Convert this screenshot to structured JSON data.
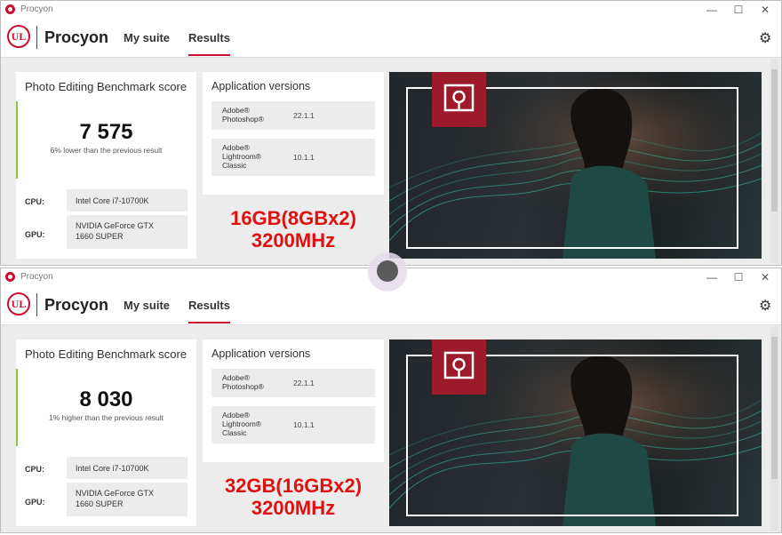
{
  "windows": [
    {
      "title": "Procyon",
      "brand": "Procyon",
      "logo_text": "UL",
      "nav": [
        {
          "label": "My suite"
        },
        {
          "label": "Results"
        }
      ],
      "score_title": "Photo Editing Benchmark score",
      "score": "7 575",
      "comparison": "6% lower than the previous result",
      "cpu_label": "CPU:",
      "cpu": "Intel Core i7-10700K",
      "gpu_label": "GPU:",
      "gpu_line1": "NVIDIA GeForce GTX",
      "gpu_line2": "1660 SUPER",
      "app_versions_title": "Application versions",
      "apps": [
        {
          "name": [
            "Adobe®",
            "Photoshop®"
          ],
          "version": "22.1.1"
        },
        {
          "name": [
            "Adobe®",
            "Lightroom®",
            "Classic"
          ],
          "version": "10.1.1"
        }
      ],
      "memory_line1": "16GB(8GBx2)",
      "memory_line2": "3200MHz"
    },
    {
      "title": "Procyon",
      "brand": "Procyon",
      "logo_text": "UL",
      "nav": [
        {
          "label": "My suite"
        },
        {
          "label": "Results"
        }
      ],
      "score_title": "Photo Editing Benchmark score",
      "score": "8 030",
      "comparison": "1% higher than the previous result",
      "cpu_label": "CPU:",
      "cpu": "Intel Core i7-10700K",
      "gpu_label": "GPU:",
      "gpu_line1": "NVIDIA GeForce GTX",
      "gpu_line2": "1660 SUPER",
      "app_versions_title": "Application versions",
      "apps": [
        {
          "name": [
            "Adobe®",
            "Photoshop®"
          ],
          "version": "22.1.1"
        },
        {
          "name": [
            "Adobe®",
            "Lightroom®",
            "Classic"
          ],
          "version": "10.1.1"
        }
      ],
      "memory_line1": "32GB(16GBx2)",
      "memory_line2": "3200MHz"
    }
  ],
  "window_controls": {
    "minimize": "—",
    "maximize": "☐",
    "close": "✕"
  },
  "icons": {
    "settings": "gear-icon",
    "app": "procyon-app-icon"
  },
  "colors": {
    "accent": "#c8102e",
    "score_bar": "#8cc63f",
    "overlay_text": "#e01010"
  }
}
